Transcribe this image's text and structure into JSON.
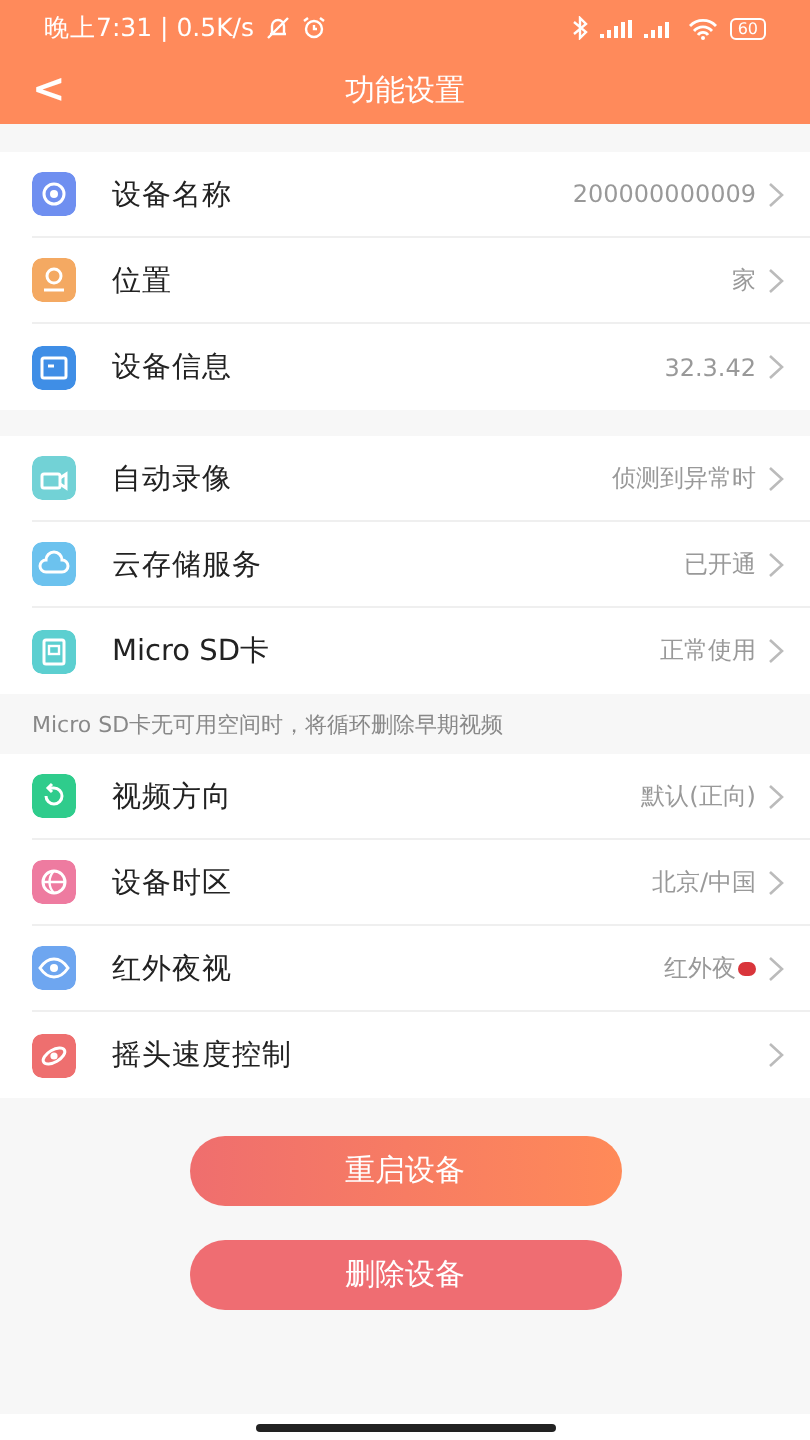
{
  "status_bar": {
    "time": "晚上7:31 | 0.5K/s",
    "battery": "60"
  },
  "navbar": {
    "back": "<",
    "title": "功能设置"
  },
  "sections": [
    {
      "rows": [
        {
          "label": "设备名称",
          "value": "200000000009",
          "color": "#6f8ff0",
          "badge": false
        },
        {
          "label": "位置",
          "value": "家",
          "color": "#f4a962",
          "badge": false
        },
        {
          "label": "设备信息",
          "value": "32.3.42",
          "color": "#3f8ee6",
          "badge": false
        }
      ]
    },
    {
      "rows": [
        {
          "label": "自动录像",
          "value": "侦测到异常时",
          "color": "#72d2d6",
          "badge": false
        },
        {
          "label": "云存储服务",
          "value": "已开通",
          "color": "#6cc2ee",
          "badge": false
        },
        {
          "label": "Micro SD卡",
          "value": "正常使用",
          "color": "#5ccfd0",
          "badge": false
        }
      ],
      "note": "Micro SD卡无可用空间时，将循环删除早期视频"
    },
    {
      "rows": [
        {
          "label": "视频方向",
          "value": "默认(正向)",
          "color": "#2fcc8c",
          "badge": false
        },
        {
          "label": "设备时区",
          "value": "北京/中国",
          "color": "#ee7ba0",
          "badge": false
        },
        {
          "label": "红外夜视",
          "value": "红外夜",
          "color": "#6ea6f0",
          "badge": true
        },
        {
          "label": "摇头速度控制",
          "value": "",
          "color": "#ee6f6f",
          "badge": false
        }
      ]
    }
  ],
  "buttons": [
    {
      "label": "重启设备",
      "kind": "primary"
    },
    {
      "label": "删除设备",
      "kind": "danger"
    }
  ]
}
